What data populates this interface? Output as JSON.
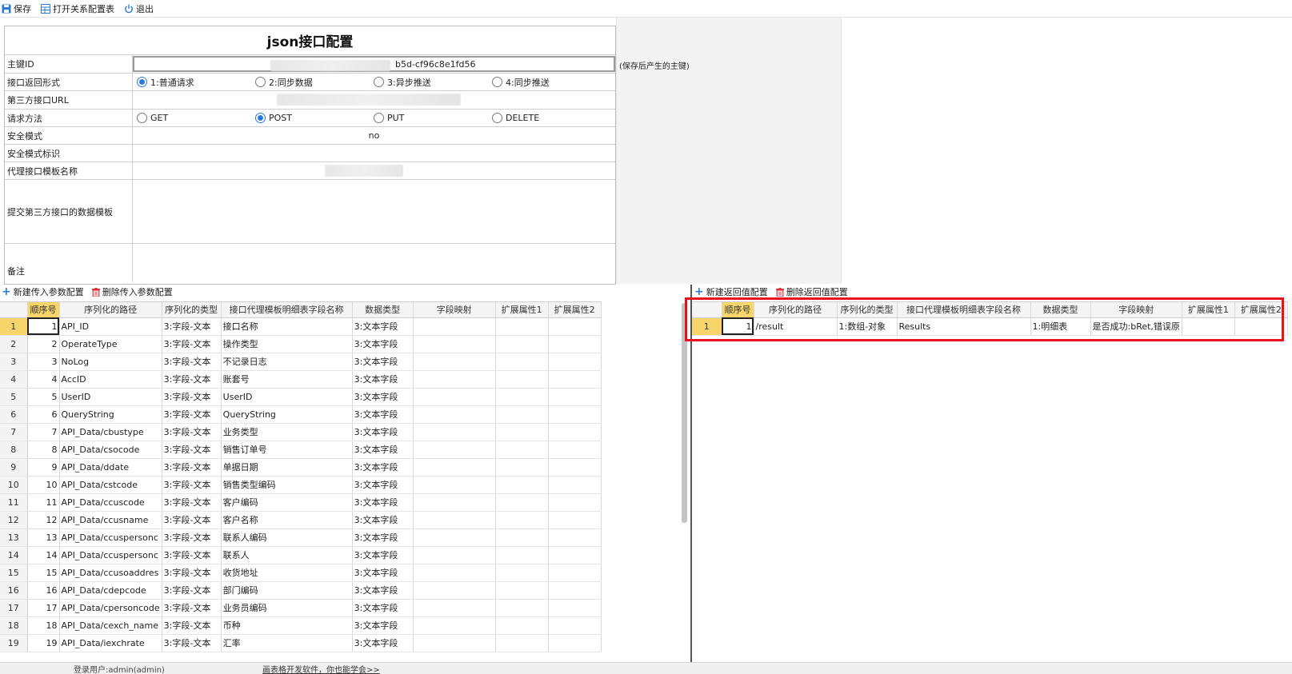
{
  "toolbar": {
    "save_label": "保存",
    "open_relation_label": "打开关系配置表",
    "exit_label": "退出"
  },
  "form": {
    "title": "json接口配置",
    "pk_label": "主键ID",
    "pk_value": "b5d-cf96c8e1fd56",
    "pk_note": "(保存后产生的主键)",
    "return_label": "接口返回形式",
    "return_options": [
      "1:普通请求",
      "2:同步数据",
      "3:异步推送",
      "4:同步推送"
    ],
    "return_selected": 0,
    "url_label": "第三方接口URL",
    "method_label": "请求方法",
    "method_options": [
      "GET",
      "POST",
      "PUT",
      "DELETE"
    ],
    "method_selected": 1,
    "security_label": "安全模式",
    "security_value": "no",
    "security_flag_label": "安全模式标识",
    "proxy_label": "代理接口模板名称",
    "template_label": "提交第三方接口的数据模板",
    "remark_label": "备注"
  },
  "left_grid": {
    "add_label": "新建传入参数配置",
    "delete_label": "删除传入参数配置",
    "headers": [
      "顺序号",
      "序列化的路径",
      "序列化的类型",
      "接口代理模板明细表字段名称",
      "数据类型",
      "字段映射",
      "扩展属性1",
      "扩展属性2"
    ],
    "rows": [
      [
        "1",
        "API_ID",
        "3:字段-文本",
        "接口名称",
        "3:文本字段"
      ],
      [
        "2",
        "OperateType",
        "3:字段-文本",
        "操作类型",
        "3:文本字段"
      ],
      [
        "3",
        "NoLog",
        "3:字段-文本",
        "不记录日志",
        "3:文本字段"
      ],
      [
        "4",
        "AccID",
        "3:字段-文本",
        "账套号",
        "3:文本字段"
      ],
      [
        "5",
        "UserID",
        "3:字段-文本",
        "UserID",
        "3:文本字段"
      ],
      [
        "6",
        "QueryString",
        "3:字段-文本",
        "QueryString",
        "3:文本字段"
      ],
      [
        "7",
        "API_Data/cbustype",
        "3:字段-文本",
        "业务类型",
        "3:文本字段"
      ],
      [
        "8",
        "API_Data/csocode",
        "3:字段-文本",
        "销售订单号",
        "3:文本字段"
      ],
      [
        "9",
        "API_Data/ddate",
        "3:字段-文本",
        "单据日期",
        "3:文本字段"
      ],
      [
        "10",
        "API_Data/cstcode",
        "3:字段-文本",
        "销售类型编码",
        "3:文本字段"
      ],
      [
        "11",
        "API_Data/ccuscode",
        "3:字段-文本",
        "客户编码",
        "3:文本字段"
      ],
      [
        "12",
        "API_Data/ccusname",
        "3:字段-文本",
        "客户名称",
        "3:文本字段"
      ],
      [
        "13",
        "API_Data/ccuspersonc",
        "3:字段-文本",
        "联系人编码",
        "3:文本字段"
      ],
      [
        "14",
        "API_Data/ccuspersonc",
        "3:字段-文本",
        "联系人",
        "3:文本字段"
      ],
      [
        "15",
        "API_Data/ccusoaddres",
        "3:字段-文本",
        "收货地址",
        "3:文本字段"
      ],
      [
        "16",
        "API_Data/cdepcode",
        "3:字段-文本",
        "部门编码",
        "3:文本字段"
      ],
      [
        "17",
        "API_Data/cpersoncode",
        "3:字段-文本",
        "业务员编码",
        "3:文本字段"
      ],
      [
        "18",
        "API_Data/cexch_name",
        "3:字段-文本",
        "币种",
        "3:文本字段"
      ],
      [
        "19",
        "API_Data/iexchrate",
        "3:字段-文本",
        "汇率",
        "3:文本字段"
      ]
    ]
  },
  "right_grid": {
    "add_label": "新建返回值配置",
    "delete_label": "删除返回值配置",
    "headers": [
      "顺序号",
      "序列化的路径",
      "序列化的类型",
      "接口代理模板明细表字段名称",
      "数据类型",
      "字段映射",
      "扩展属性1",
      "扩展属性2"
    ],
    "rows": [
      [
        "1",
        "/result",
        "1:数组-对象",
        "Results",
        "1:明细表",
        "是否成功:bRet,错误原"
      ]
    ]
  },
  "status": {
    "user": "登录用户:admin(admin)",
    "promo": "画表格开发软件，你也能学会>>"
  },
  "colors": {
    "accent": "#2a7bd6",
    "highlight": "#f7d56a",
    "annotation_red": "#e8121f"
  }
}
